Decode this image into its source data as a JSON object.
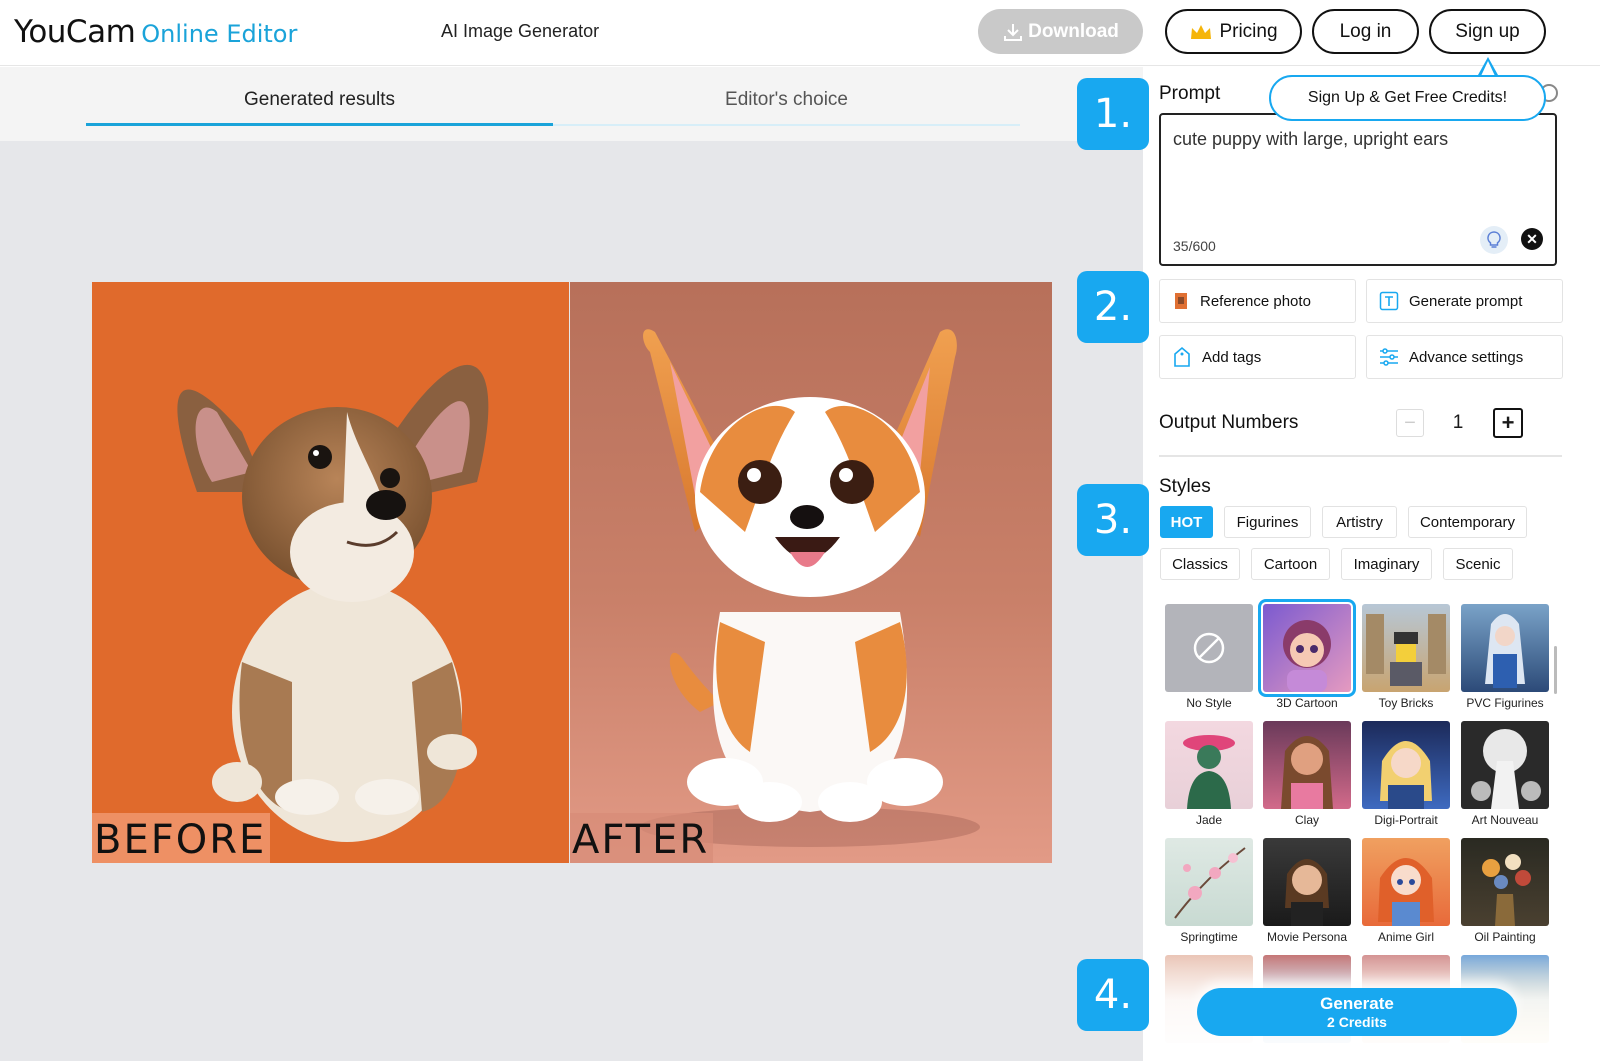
{
  "header": {
    "logo_main": "YouCam",
    "logo_sub": "Online Editor",
    "app_title": "AI Image Generator",
    "download_label": "Download",
    "pricing_label": "Pricing",
    "login_label": "Log in",
    "signup_label": "Sign up"
  },
  "tabs": [
    {
      "label": "Generated results",
      "active": true
    },
    {
      "label": "Editor's choice",
      "active": false
    }
  ],
  "comparison": {
    "before_label": "BEFORE",
    "after_label": "AFTER"
  },
  "steps": [
    "1.",
    "2.",
    "3.",
    "4."
  ],
  "tooltip": "Sign Up & Get Free Credits!",
  "prompt": {
    "label": "Prompt",
    "value": "cute puppy with large, upright ears",
    "count": "35/600"
  },
  "tools": {
    "reference_photo": "Reference photo",
    "generate_prompt": "Generate prompt",
    "add_tags": "Add tags",
    "advance_settings": "Advance settings"
  },
  "output": {
    "label": "Output Numbers",
    "value": "1",
    "minus": "−",
    "plus": "+"
  },
  "styles": {
    "label": "Styles",
    "categories": [
      "HOT",
      "Figurines",
      "Artistry",
      "Contemporary",
      "Classics",
      "Cartoon",
      "Imaginary",
      "Scenic"
    ],
    "active_category": "HOT",
    "items": [
      "No Style",
      "3D Cartoon",
      "Toy Bricks",
      "PVC Figurines",
      "Jade",
      "Clay",
      "Digi-Portrait",
      "Art Nouveau",
      "Springtime",
      "Movie Persona",
      "Anime Girl",
      "Oil Painting"
    ],
    "selected_item": "3D Cartoon"
  },
  "generate": {
    "label": "Generate",
    "credits": "2 Credits"
  },
  "colors": {
    "accent": "#18a8f0",
    "before_bg": "#e06a2c",
    "after_bg": "#c47a64"
  }
}
